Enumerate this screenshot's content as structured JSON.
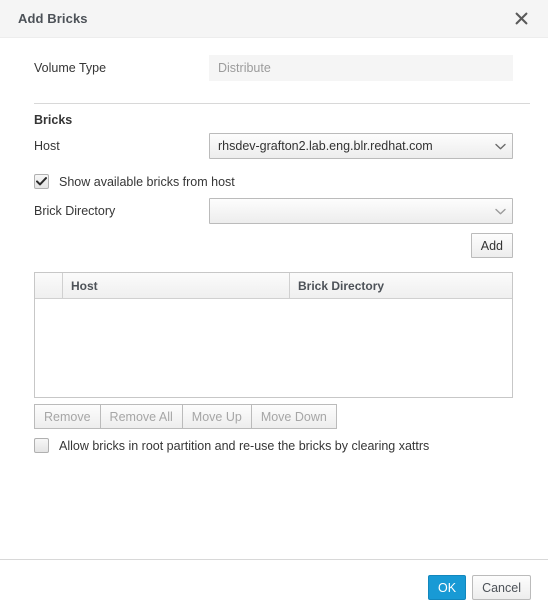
{
  "dialog": {
    "title": "Add Bricks",
    "close_icon": "close-icon"
  },
  "form": {
    "volume_type": {
      "label": "Volume Type",
      "value": "Distribute"
    }
  },
  "bricks_section": {
    "heading": "Bricks",
    "host": {
      "label": "Host",
      "value": "rhsdev-grafton2.lab.eng.blr.redhat.com",
      "caret_icon": "chevron-down-icon"
    },
    "show_available": {
      "label": "Show available bricks from host",
      "checked": true,
      "check_icon": "check-icon"
    },
    "brick_directory": {
      "label": "Brick Directory",
      "value": "",
      "caret_icon": "chevron-down-icon"
    },
    "add_button": "Add"
  },
  "table": {
    "columns": [
      "",
      "Host",
      "Brick Directory"
    ],
    "rows": []
  },
  "table_toolbar": {
    "buttons": [
      {
        "label": "Remove",
        "disabled": true
      },
      {
        "label": "Remove All",
        "disabled": true
      },
      {
        "label": "Move Up",
        "disabled": true
      },
      {
        "label": "Move Down",
        "disabled": true
      }
    ]
  },
  "allow_root": {
    "label": "Allow bricks in root partition and re-use the bricks by clearing xattrs",
    "checked": false
  },
  "footer": {
    "ok_label": "OK",
    "cancel_label": "Cancel"
  },
  "colors": {
    "primary": "#189ad5",
    "header_bg": "#f5f5f5",
    "text": "#363636",
    "muted": "#9c9c9c"
  }
}
